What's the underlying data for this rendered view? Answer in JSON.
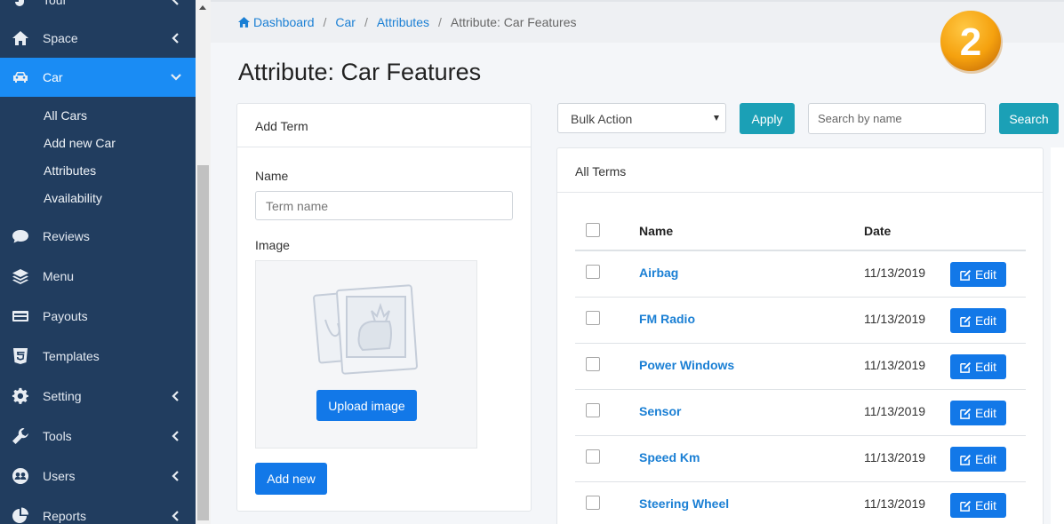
{
  "sidebar": {
    "items": [
      {
        "label": "Tour",
        "icon": "tour-icon"
      },
      {
        "label": "Space",
        "icon": "home-icon"
      },
      {
        "label": "Car",
        "icon": "car-icon"
      },
      {
        "label": "Reviews",
        "icon": "comment-icon"
      },
      {
        "label": "Menu",
        "icon": "layers-icon"
      },
      {
        "label": "Payouts",
        "icon": "credit-card-icon"
      },
      {
        "label": "Templates",
        "icon": "html5-icon"
      },
      {
        "label": "Setting",
        "icon": "gear-icon"
      },
      {
        "label": "Tools",
        "icon": "wrench-icon"
      },
      {
        "label": "Users",
        "icon": "users-icon"
      },
      {
        "label": "Reports",
        "icon": "pie-chart-icon"
      }
    ],
    "car_submenu": [
      "All Cars",
      "Add new Car",
      "Attributes",
      "Availability"
    ],
    "active_color": "#1a8cf4",
    "background_color": "#213d5f"
  },
  "breadcrumb": {
    "items": [
      "Dashboard",
      "Car",
      "Attributes"
    ],
    "current": "Attribute: Car Features",
    "separator": "/"
  },
  "step_badge": "2",
  "page_title": "Attribute: Car Features",
  "add_term": {
    "title": "Add Term",
    "name_label": "Name",
    "name_placeholder": "Term name",
    "image_label": "Image",
    "upload_label": "Upload image",
    "add_new_label": "Add new"
  },
  "toolbar": {
    "bulk_action": "Bulk Action",
    "apply_label": "Apply",
    "search_placeholder": "Search by name",
    "search_label": "Search"
  },
  "terms": {
    "title": "All Terms",
    "columns": [
      "Name",
      "Date"
    ],
    "rows": [
      {
        "name": "Airbag",
        "date": "11/13/2019",
        "action": "Edit"
      },
      {
        "name": "FM Radio",
        "date": "11/13/2019",
        "action": "Edit"
      },
      {
        "name": "Power Windows",
        "date": "11/13/2019",
        "action": "Edit"
      },
      {
        "name": "Sensor",
        "date": "11/13/2019",
        "action": "Edit"
      },
      {
        "name": "Speed Km",
        "date": "11/13/2019",
        "action": "Edit"
      },
      {
        "name": "Steering Wheel",
        "date": "11/13/2019",
        "action": "Edit"
      }
    ]
  },
  "colors": {
    "primary_button": "#1278e8",
    "teal_button": "#1ba0b6",
    "link": "#1a7fd4",
    "badge": "#f5a623"
  }
}
